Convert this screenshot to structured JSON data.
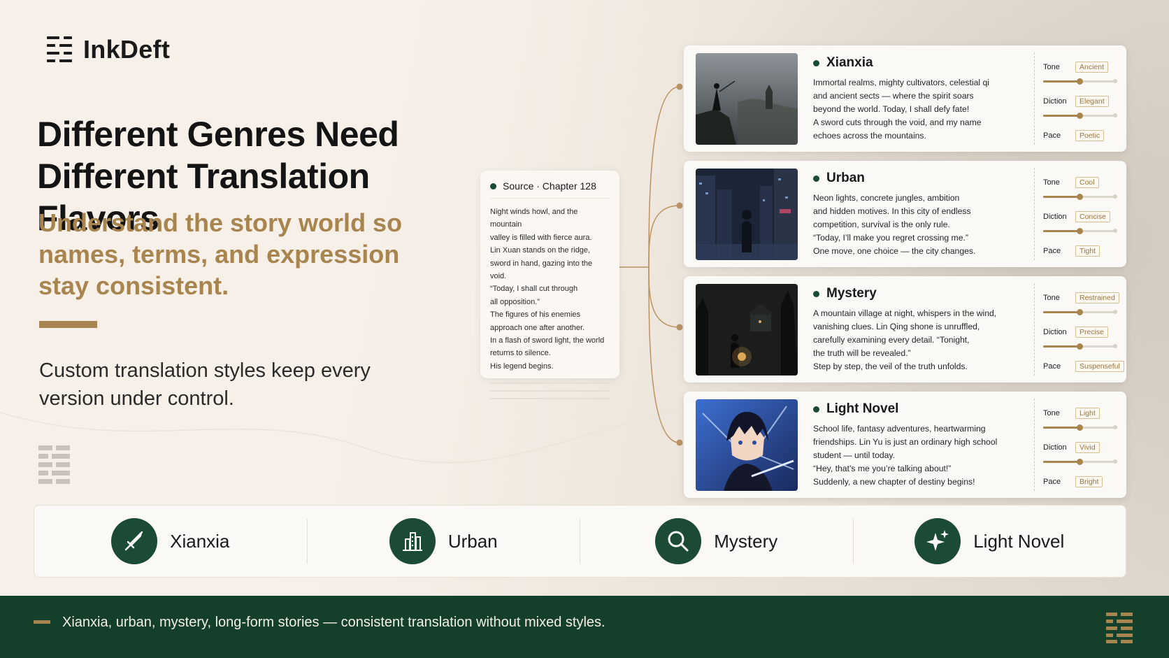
{
  "brand": {
    "name": "InkDeft",
    "logo_icon": "stacked-lines-logo-icon"
  },
  "hero": {
    "headline_line1": "Different Genres Need",
    "headline_line2": "Different Translation Flavors",
    "subhead": "Understand the story world so names, terms, and expression stay consistent.",
    "body": "Custom translation styles keep every version under control."
  },
  "source": {
    "title": "Source · Chapter 128",
    "lines": [
      "Night winds howl, and the mountain",
      "valley is filled with fierce aura.",
      "Lin Xuan stands on the ridge,",
      "sword in hand, gazing into the void.",
      "“Today, I shall cut through",
      "all opposition.”",
      "The figures of his enemies",
      "approach one after another.",
      "In a flash of sword light, the world",
      "returns to silence.",
      "His legend begins."
    ]
  },
  "genres": [
    {
      "title": "Xianxia",
      "image": "xianxia-swordsman-cliff-image",
      "lines": [
        "Immortal realms, mighty cultivators, celestial qi",
        "and ancient sects — where the spirit soars",
        "beyond the world.  Today, I shall defy fate!",
        "A sword cuts through the void, and my name",
        "echoes across the mountains."
      ],
      "controls": [
        {
          "label": "Tone",
          "value": "Ancient",
          "level": 0.5
        },
        {
          "label": "Diction",
          "value": "Elegant",
          "level": 0.5
        },
        {
          "label": "Pace",
          "value": "Poetic"
        }
      ]
    },
    {
      "title": "Urban",
      "image": "urban-night-city-image",
      "lines": [
        "Neon lights, concrete jungles, ambition",
        "and hidden motives. In this city of endless",
        "competition, survival is the only rule.",
        "“Today, I’ll make you regret crossing me.”",
        "One move, one choice — the city changes."
      ],
      "controls": [
        {
          "label": "Tone",
          "value": "Cool",
          "level": 0.5
        },
        {
          "label": "Diction",
          "value": "Concise",
          "level": 0.5
        },
        {
          "label": "Pace",
          "value": "Tight"
        }
      ]
    },
    {
      "title": "Mystery",
      "image": "mystery-dark-forest-image",
      "lines": [
        "A mountain village at night, whispers in the wind,",
        "vanishing clues. Lin Qing shone is unruffled,",
        "carefully examining every detail. “Tonight,",
        "the truth will be revealed.”",
        "Step by step, the veil of the truth unfolds."
      ],
      "controls": [
        {
          "label": "Tone",
          "value": "Restrained",
          "level": 0.5
        },
        {
          "label": "Diction",
          "value": "Precise",
          "level": 0.5
        },
        {
          "label": "Pace",
          "value": "Suspenseful"
        }
      ]
    },
    {
      "title": "Light Novel",
      "image": "light-novel-anime-hero-image",
      "lines": [
        "School life, fantasy adventures, heartwarming",
        "friendships. Lin Yu is just an ordinary high school",
        "student — until today.",
        "“Hey, that’s me you’re talking about!”",
        "Suddenly, a new chapter of destiny begins!"
      ],
      "controls": [
        {
          "label": "Tone",
          "value": "Light",
          "level": 0.5
        },
        {
          "label": "Diction",
          "value": "Vivid",
          "level": 0.5
        },
        {
          "label": "Pace",
          "value": "Bright"
        }
      ]
    }
  ],
  "tabs": [
    {
      "label": "Xianxia",
      "icon": "sword-icon"
    },
    {
      "label": "Urban",
      "icon": "city-buildings-icon"
    },
    {
      "label": "Mystery",
      "icon": "magnifier-icon"
    },
    {
      "label": "Light Novel",
      "icon": "sparkles-icon"
    }
  ],
  "footer": {
    "text": "Xianxia, urban, mystery, long-form stories — consistent translation without mixed styles."
  },
  "colors": {
    "brand_green": "#1b4a35",
    "accent_gold": "#a8844e",
    "background": "#f5efe7"
  }
}
